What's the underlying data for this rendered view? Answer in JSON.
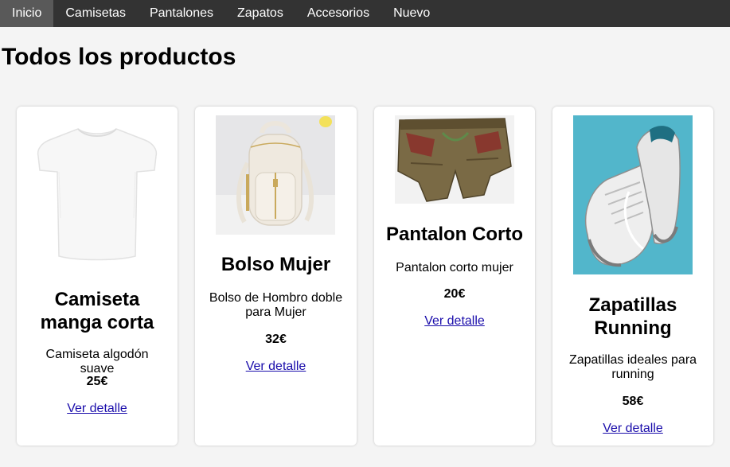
{
  "nav": {
    "items": [
      {
        "label": "Inicio"
      },
      {
        "label": "Camisetas"
      },
      {
        "label": "Pantalones"
      },
      {
        "label": "Zapatos"
      },
      {
        "label": "Accesorios"
      },
      {
        "label": "Nuevo"
      }
    ]
  },
  "page": {
    "title": "Todos los productos"
  },
  "products": [
    {
      "name": "Camiseta manga corta",
      "description": "Camiseta algodón suave",
      "price": "25€",
      "link": "Ver detalle"
    },
    {
      "name": "Bolso Mujer",
      "description": "Bolso de Hombro doble para Mujer",
      "price": "32€",
      "link": "Ver detalle"
    },
    {
      "name": "Pantalon Corto",
      "description": "Pantalon corto mujer",
      "price": "20€",
      "link": "Ver detalle"
    },
    {
      "name": "Zapatillas Running",
      "description": "Zapatillas ideales para running",
      "price": "58€",
      "link": "Ver detalle"
    }
  ],
  "colors": {
    "nav_bg": "#333333",
    "nav_active": "#595959",
    "page_bg": "#f4f4f4",
    "link": "#1a0dab"
  }
}
